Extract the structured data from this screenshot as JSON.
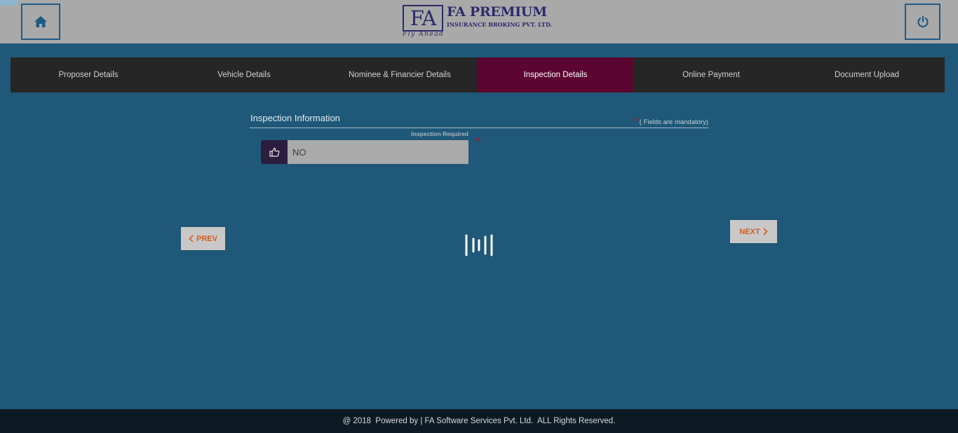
{
  "header": {
    "home_icon": "home-icon",
    "power_icon": "power-icon",
    "logo": {
      "mark": "FA",
      "title": "FA PREMIUM",
      "subtitle": "INSURANCE BROKING PVT. LTD.",
      "tagline": "Fly Ahead"
    }
  },
  "tabs": [
    {
      "label": "Proposer Details"
    },
    {
      "label": "Vehicle Details"
    },
    {
      "label": "Nominee & Financier Details"
    },
    {
      "label": "Inspection Details",
      "active": true
    },
    {
      "label": "Online Payment"
    },
    {
      "label": "Document Upload"
    }
  ],
  "form": {
    "section_title": "Inspection Information",
    "mandatory_star": "*",
    "mandatory_note": "( Fields are mandatory)",
    "inspection_field": {
      "label": "Inspection Required",
      "value": "NO",
      "icon": "thumbs-up-icon",
      "required_star": "*"
    }
  },
  "nav": {
    "prev_label": "PREV",
    "next_label": "NEXT"
  },
  "footer": {
    "text": "@ 2018  Powered by | FA Software Services Pvt. Ltd.  ALL Rights Reserved."
  },
  "colors": {
    "background": "#1f5878",
    "header": "#a9a9a9",
    "tab_bar": "#262626",
    "active_tab": "#5c0531",
    "nav_text": "#d55a1f",
    "footer": "#0c1b23"
  }
}
